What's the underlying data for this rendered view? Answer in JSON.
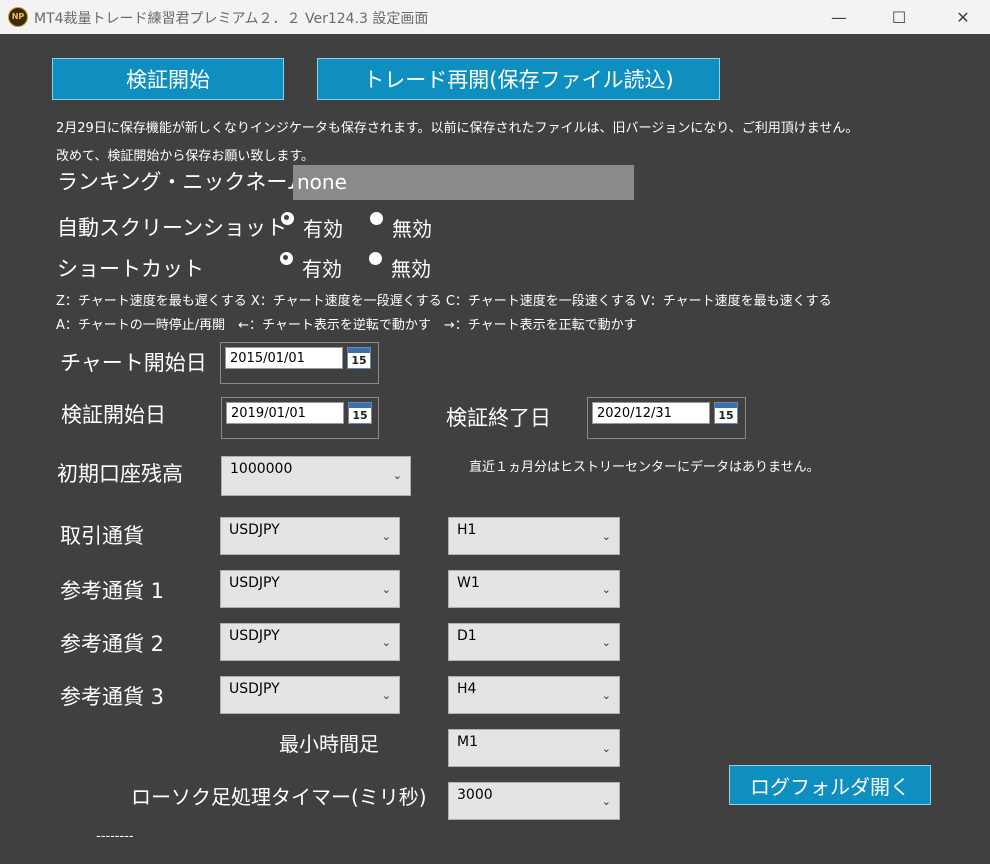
{
  "window": {
    "title": "MT4裁量トレード練習君プレミアム２．２ Ver124.3 設定画面",
    "minimize_glyph": "—",
    "maximize_glyph": "☐",
    "close_glyph": "✕",
    "icon": "app-logo-icon"
  },
  "buttons": {
    "start_verification": "検証開始",
    "resume_trade": "トレード再開(保存ファイル読込)",
    "open_log_folder": "ログフォルダ開く"
  },
  "notice": {
    "line1": "2月29日に保存機能が新しくなりインジケータも保存されます。以前に保存されたファイルは、旧バージョンになり、ご利用頂けません。",
    "line2": "改めて、検証開始から保存お願い致します。"
  },
  "nickname": {
    "label": "ランキング・ニックネーム",
    "value": "none"
  },
  "auto_screenshot": {
    "label": "自動スクリーンショット",
    "enabled_label": "有効",
    "disabled_label": "無効",
    "selected": "enabled"
  },
  "shortcut": {
    "label": "ショートカット",
    "enabled_label": "有効",
    "disabled_label": "無効",
    "selected": "enabled",
    "help_line1": "Z：チャート速度を最も遅くする X：チャート速度を一段遅くする C：チャート速度を一段速くする V：チャート速度を最も速くする",
    "help_line2": "A：チャートの一時停止/再開　←：チャート表示を逆転で動かす　→：チャート表示を正転で動かす"
  },
  "dates": {
    "calendar_number": "15",
    "chart_start_label": "チャート開始日",
    "chart_start_value": "2015/01/01",
    "verify_start_label": "検証開始日",
    "verify_start_value": "2019/01/01",
    "verify_end_label": "検証終了日",
    "verify_end_value": "2020/12/31"
  },
  "balance": {
    "label": "初期口座残高",
    "value": "1000000",
    "history_note": "直近１ヵ月分はヒストリーセンターにデータはありません。"
  },
  "currencies": {
    "trade_label": "取引通貨",
    "trade_symbol": "USDJPY",
    "trade_timeframe": "H1",
    "ref1_label": "参考通貨 1",
    "ref1_symbol": "USDJPY",
    "ref1_timeframe": "W1",
    "ref2_label": "参考通貨 2",
    "ref2_symbol": "USDJPY",
    "ref2_timeframe": "D1",
    "ref3_label": "参考通貨 3",
    "ref3_symbol": "USDJPY",
    "ref3_timeframe": "H4"
  },
  "min_timeframe": {
    "label": "最小時間足",
    "value": "M1"
  },
  "timer": {
    "label": "ローソク足処理タイマー(ミリ秒)",
    "value": "3000"
  },
  "footer": {
    "status": "--------"
  },
  "colors": {
    "background": "#404040",
    "accent_button": "#0f8fbf"
  }
}
